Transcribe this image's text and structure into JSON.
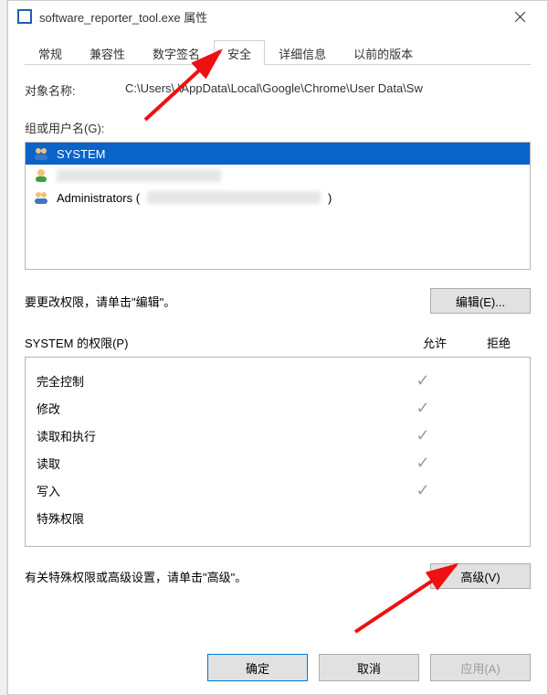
{
  "window": {
    "title": "software_reporter_tool.exe 属性"
  },
  "tabs": {
    "items": [
      {
        "label": "常规"
      },
      {
        "label": "兼容性"
      },
      {
        "label": "数字签名"
      },
      {
        "label": "安全"
      },
      {
        "label": "详细信息"
      },
      {
        "label": "以前的版本"
      }
    ],
    "active_index": 3
  },
  "object_name": {
    "label": "对象名称:",
    "value": "C:\\Users\\      \\AppData\\Local\\Google\\Chrome\\User Data\\Sw"
  },
  "groups": {
    "label": "组或用户名(G):",
    "items": [
      {
        "name": "SYSTEM",
        "icon": "users-icon",
        "selected": true
      },
      {
        "name": "",
        "icon": "user-green-icon",
        "selected": false,
        "redacted": true
      },
      {
        "name": "Administrators (",
        "suffix": ")",
        "icon": "users-icon",
        "selected": false,
        "redacted": true
      }
    ]
  },
  "edit_hint": "要更改权限，请单击\"编辑\"。",
  "buttons": {
    "edit": "编辑(E)...",
    "advanced": "高级(V)",
    "ok": "确定",
    "cancel": "取消",
    "apply": "应用(A)"
  },
  "permissions": {
    "header_name": "SYSTEM 的权限(P)",
    "header_allow": "允许",
    "header_deny": "拒绝",
    "rows": [
      {
        "name": "完全控制",
        "allow": true,
        "deny": false
      },
      {
        "name": "修改",
        "allow": true,
        "deny": false
      },
      {
        "name": "读取和执行",
        "allow": true,
        "deny": false
      },
      {
        "name": "读取",
        "allow": true,
        "deny": false
      },
      {
        "name": "写入",
        "allow": true,
        "deny": false
      },
      {
        "name": "特殊权限",
        "allow": false,
        "deny": false
      }
    ]
  },
  "advanced_hint": "有关特殊权限或高级设置，请单击\"高级\"。"
}
